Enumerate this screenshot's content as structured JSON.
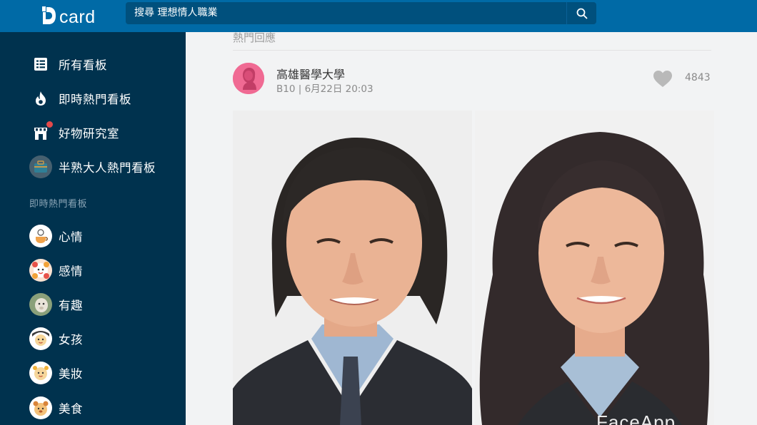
{
  "app": {
    "logo_text": "card"
  },
  "search": {
    "placeholder": "搜尋 理想情人職業"
  },
  "sidebar": {
    "main_items": [
      {
        "label": "所有看板",
        "icon": "board-list-icon"
      },
      {
        "label": "即時熱門看板",
        "icon": "fire-icon"
      },
      {
        "label": "好物研究室",
        "icon": "store-icon"
      },
      {
        "label": "半熟大人熱門看板",
        "icon": "briefcase-icon"
      }
    ],
    "section_title": "即時熱門看板",
    "forum_items": [
      {
        "label": "心情",
        "icon": "mood-icon"
      },
      {
        "label": "感情",
        "icon": "relationship-icon"
      },
      {
        "label": "有趣",
        "icon": "funny-icon"
      },
      {
        "label": "女孩",
        "icon": "girl-icon"
      },
      {
        "label": "美妝",
        "icon": "makeup-icon"
      },
      {
        "label": "美食",
        "icon": "food-icon"
      }
    ]
  },
  "main": {
    "section_head": "熱門回應",
    "post": {
      "school": "高雄醫學大學",
      "meta": "B10 | 6月22日 20:03",
      "like_count": "4843",
      "watermark": "FaceApp"
    }
  },
  "colors": {
    "topbar": "#006aa6",
    "sidebar": "#00324e",
    "avatar_pink": "#f06a93",
    "badge_red": "#e3494a"
  }
}
